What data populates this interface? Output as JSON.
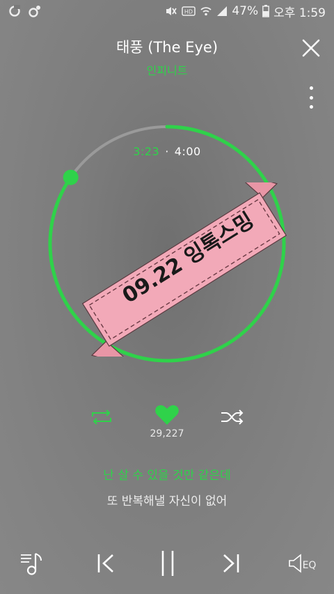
{
  "status_bar": {
    "left_icons": [
      "o-app-icon",
      "notification-icon"
    ],
    "right_icons": [
      "mute-vibrate-icon",
      "hd-icon",
      "wifi-icon",
      "signal-icon"
    ],
    "battery_percent": "47%",
    "clock": "오후 1:59"
  },
  "player": {
    "song_title": "태풍 (The Eye)",
    "artist": "인피니트",
    "elapsed": "3:23",
    "separator": "·",
    "total": "4:00",
    "progress_fraction": 0.846,
    "banner_text": "09.22 잉톡스밍",
    "like_count": "29,227",
    "lyric_current": "난 살 수 있을 것만 같은데",
    "lyric_next": "또 반복해낼 자신이 없어",
    "eq_label": "EQ"
  },
  "colors": {
    "accent": "#2fd24a",
    "ring_track": "#9a9a9a",
    "banner_fill": "#f2a9b8",
    "background": "#7d7d7d"
  }
}
